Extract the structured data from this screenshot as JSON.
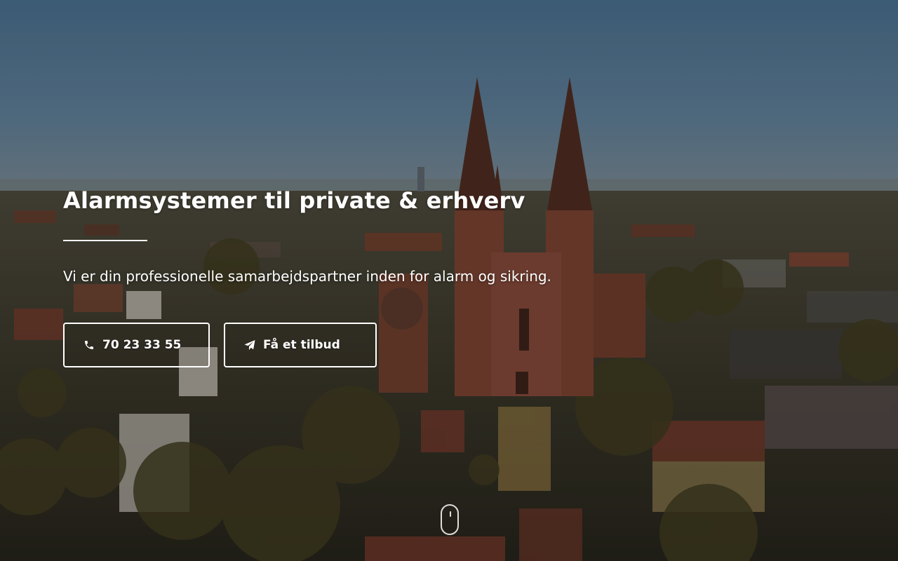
{
  "hero": {
    "title": "Alarmsystemer til private & erhverv",
    "subtitle": "Vi er din professionelle samarbejdspartner inden for alarm og sikring.",
    "background_image": "aerial-cathedral-town",
    "colors": {
      "text": "#ffffff",
      "button_border": "#ffffff"
    }
  },
  "buttons": {
    "phone": {
      "icon": "phone-icon",
      "label": "70 23 33 55"
    },
    "offer": {
      "icon": "paper-plane-icon",
      "label": "Få et tilbud"
    }
  },
  "scroll_indicator": {
    "icon": "mouse-scroll-icon"
  }
}
